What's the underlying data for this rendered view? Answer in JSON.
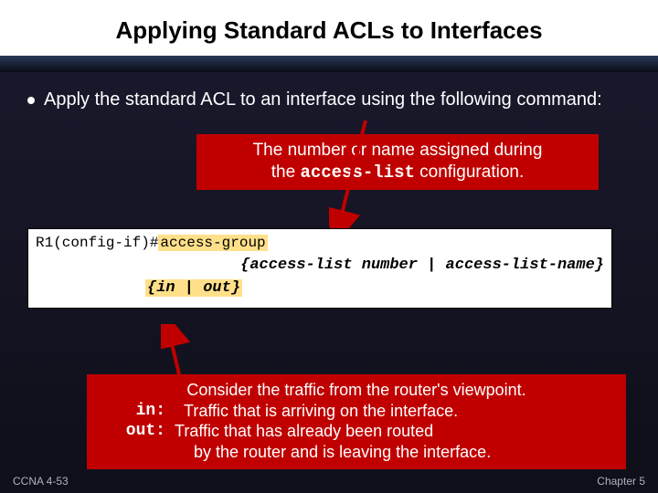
{
  "title": "Applying Standard ACLs to Interfaces",
  "bullet": "Apply the standard ACL to an interface using the following command:",
  "callout1": {
    "line1": "The number or name assigned during",
    "line2a": "the ",
    "mono": "access-list",
    "line2b": " configuration."
  },
  "code": {
    "prompt": "R1(config-if)#",
    "cmd": "access-group",
    "args": "{access-list number | access-list-name}",
    "dir": "{in | out}"
  },
  "callout2": {
    "line1": "Consider the traffic from the router's viewpoint.",
    "in_label": "in:",
    "in_text": "Traffic that is arriving on the interface.",
    "out_label": "out:",
    "out_text1": "Traffic that has already been routed",
    "out_text2": "by the router and is leaving the interface."
  },
  "footer": {
    "left": "CCNA 4-53",
    "right": "Chapter 5"
  }
}
